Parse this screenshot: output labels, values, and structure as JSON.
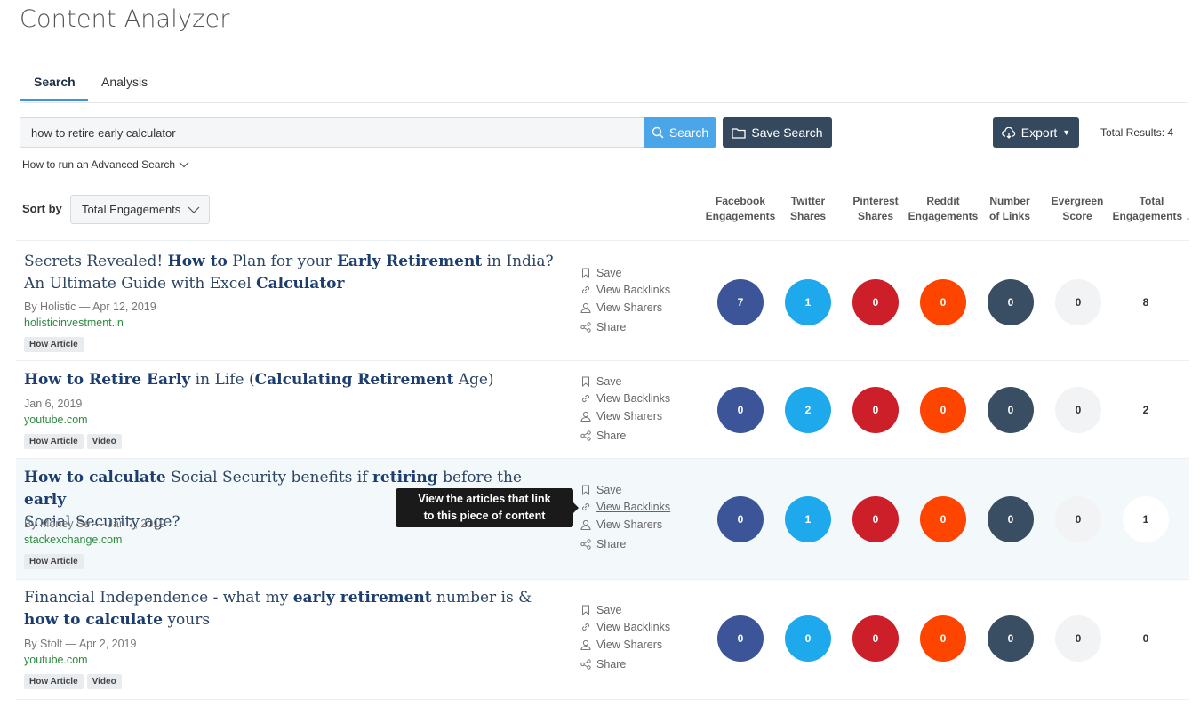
{
  "page": {
    "title": "Content Analyzer"
  },
  "tabs": [
    {
      "label": "Search",
      "active": true
    },
    {
      "label": "Analysis",
      "active": false
    }
  ],
  "search": {
    "value": "how to retire early calculator",
    "button_label": "Search",
    "save_label": "Save Search",
    "export_label": "Export",
    "total_results": "Total Results: 4",
    "advanced_link": "How to run an Advanced Search"
  },
  "sort": {
    "label": "Sort by",
    "selected": "Total Engagements"
  },
  "columns": [
    {
      "line1": "Facebook",
      "line2": "Engagements"
    },
    {
      "line1": "Twitter",
      "line2": "Shares"
    },
    {
      "line1": "Pinterest",
      "line2": "Shares"
    },
    {
      "line1": "Reddit",
      "line2": "Engagements"
    },
    {
      "line1": "Number",
      "line2": "of Links"
    },
    {
      "line1": "Evergreen",
      "line2": "Score"
    },
    {
      "line1": "Total",
      "line2": "Engagements"
    }
  ],
  "actions": {
    "save": "Save",
    "backlinks": "View Backlinks",
    "sharers": "View Sharers",
    "share": "Share"
  },
  "tooltip": {
    "line1": "View the articles that link",
    "line2": "to this piece of content"
  },
  "results": [
    {
      "meta": "By Holistic — Apr 12, 2019",
      "domain": "holisticinvestment.in",
      "tags": [
        "How Article"
      ],
      "metrics": {
        "facebook": "7",
        "twitter": "1",
        "pinterest": "0",
        "reddit": "0",
        "links": "0",
        "evergreen": "0",
        "total": "8"
      }
    },
    {
      "meta": "Jan 6, 2019",
      "domain": "youtube.com",
      "tags": [
        "How Article",
        "Video"
      ],
      "metrics": {
        "facebook": "0",
        "twitter": "2",
        "pinterest": "0",
        "reddit": "0",
        "links": "0",
        "evergreen": "0",
        "total": "2"
      }
    },
    {
      "meta": "By Money Se — Jan 7, 2019",
      "domain": "stackexchange.com",
      "tags": [
        "How Article"
      ],
      "metrics": {
        "facebook": "0",
        "twitter": "1",
        "pinterest": "0",
        "reddit": "0",
        "links": "0",
        "evergreen": "0",
        "total": "1"
      }
    },
    {
      "meta": "By Stolt — Apr 2, 2019",
      "domain": "youtube.com",
      "tags": [
        "How Article",
        "Video"
      ],
      "metrics": {
        "facebook": "0",
        "twitter": "0",
        "pinterest": "0",
        "reddit": "0",
        "links": "0",
        "evergreen": "0",
        "total": "0"
      }
    }
  ],
  "titles": {
    "r0": {
      "a": "Secrets Revealed! ",
      "b": "How to",
      "c": " Plan for your ",
      "d": "Early Retirement",
      "e": " in India? An Ultimate Guide with Excel ",
      "f": "Calculator"
    },
    "r1": {
      "a": "How to Retire Early",
      "b": " in Life (",
      "c": "Calculating Retirement",
      "d": " Age)"
    },
    "r2": {
      "a": "How to calculate",
      "b": " Social Security benefits if ",
      "c": "retiring",
      "d": " before the ",
      "e": "early",
      "f": " Social Security age?"
    },
    "r3": {
      "a": "Financial Independence - what my ",
      "b": "early retirement",
      "c": " number is & ",
      "d": "how to calculate",
      "e": " yours"
    }
  },
  "colors": {
    "facebook": "#3b5598",
    "twitter": "#1da9ec",
    "pinterest": "#cd1f2a",
    "reddit": "#fe4500",
    "links": "#3a4e63",
    "evergreen": "#f2f3f4",
    "accent": "#4aa6e8",
    "dark_button": "#34495e",
    "domain": "#2e8b3e"
  },
  "icons": [
    "search-icon",
    "folder-icon",
    "cloud-download-icon",
    "caret-down-icon",
    "chevron-down-icon",
    "bookmark-icon",
    "link-icon",
    "user-icon",
    "share-icon",
    "sort-arrow-down-icon"
  ]
}
